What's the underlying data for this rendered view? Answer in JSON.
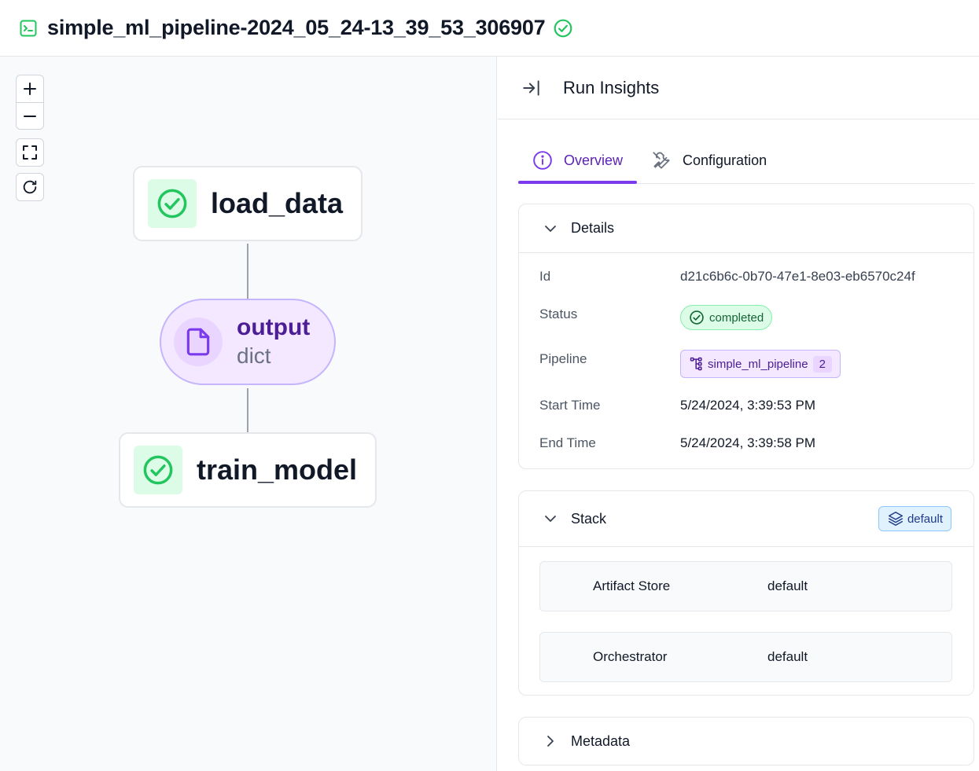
{
  "header": {
    "run_name": "simple_ml_pipeline-2024_05_24-13_39_53_306907",
    "icon": "terminal-icon",
    "status_icon": "check-circle-icon"
  },
  "canvas": {
    "controls": [
      "zoom-in",
      "zoom-out",
      "fit-view",
      "refresh"
    ],
    "nodes": {
      "step1": {
        "label": "load_data",
        "status": "completed"
      },
      "artifact": {
        "name": "output",
        "type": "dict"
      },
      "step2": {
        "label": "train_model",
        "status": "completed"
      }
    }
  },
  "panel": {
    "title": "Run Insights",
    "tabs": [
      {
        "label": "Overview",
        "icon": "info-icon",
        "active": true
      },
      {
        "label": "Configuration",
        "icon": "tools-icon",
        "active": false
      }
    ],
    "details": {
      "title": "Details",
      "id_label": "Id",
      "id_value": "d21c6b6c-0b70-47e1-8e03-eb6570c24f",
      "status_label": "Status",
      "status_value": "completed",
      "pipeline_label": "Pipeline",
      "pipeline_name": "simple_ml_pipeline",
      "pipeline_version": "2",
      "start_label": "Start Time",
      "start_value": "5/24/2024, 3:39:53 PM",
      "end_label": "End Time",
      "end_value": "5/24/2024, 3:39:58 PM"
    },
    "stack": {
      "title": "Stack",
      "badge": "default",
      "components": [
        {
          "label": "Artifact Store",
          "value": "default"
        },
        {
          "label": "Orchestrator",
          "value": "default"
        }
      ]
    },
    "metadata": {
      "title": "Metadata"
    }
  },
  "colors": {
    "success": "#22c55e",
    "accent": "#7c3aed",
    "border": "#e5e7eb"
  }
}
